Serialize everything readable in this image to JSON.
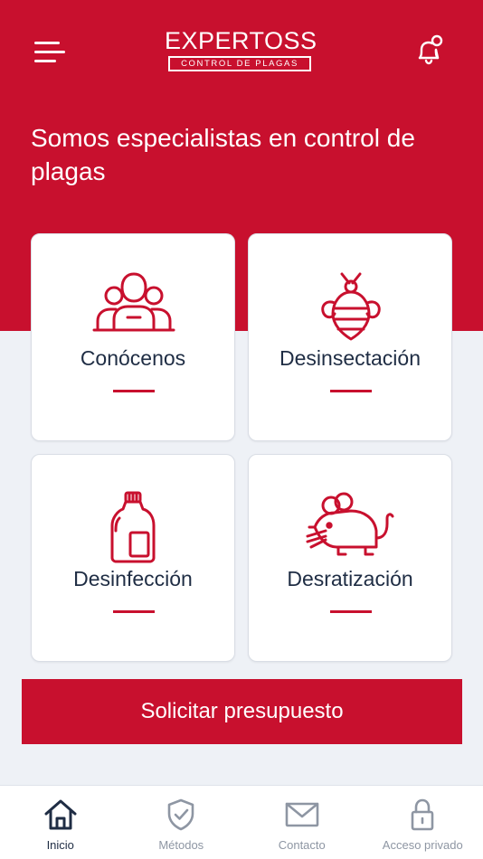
{
  "header": {
    "logo_main": "EXPERTOSS",
    "logo_sub": "CONTROL DE PLAGAS",
    "headline": "Somos especialistas en control de plagas"
  },
  "colors": {
    "brand_red": "#c8102e",
    "dark_text": "#1f2d44",
    "inactive_gray": "#8e96a3"
  },
  "cards": [
    {
      "label": "Conócenos",
      "icon": "people-group-icon"
    },
    {
      "label": "Desinsectación",
      "icon": "bee-icon"
    },
    {
      "label": "Desinfección",
      "icon": "bleach-bottle-icon"
    },
    {
      "label": "Desratización",
      "icon": "rat-icon"
    }
  ],
  "cta": {
    "label": "Solicitar presupuesto"
  },
  "tabs": [
    {
      "label": "Inicio",
      "icon": "home-icon",
      "active": true
    },
    {
      "label": "Métodos",
      "icon": "shield-check-icon",
      "active": false
    },
    {
      "label": "Contacto",
      "icon": "mail-icon",
      "active": false
    },
    {
      "label": "Acceso privado",
      "icon": "lock-icon",
      "active": false
    }
  ]
}
